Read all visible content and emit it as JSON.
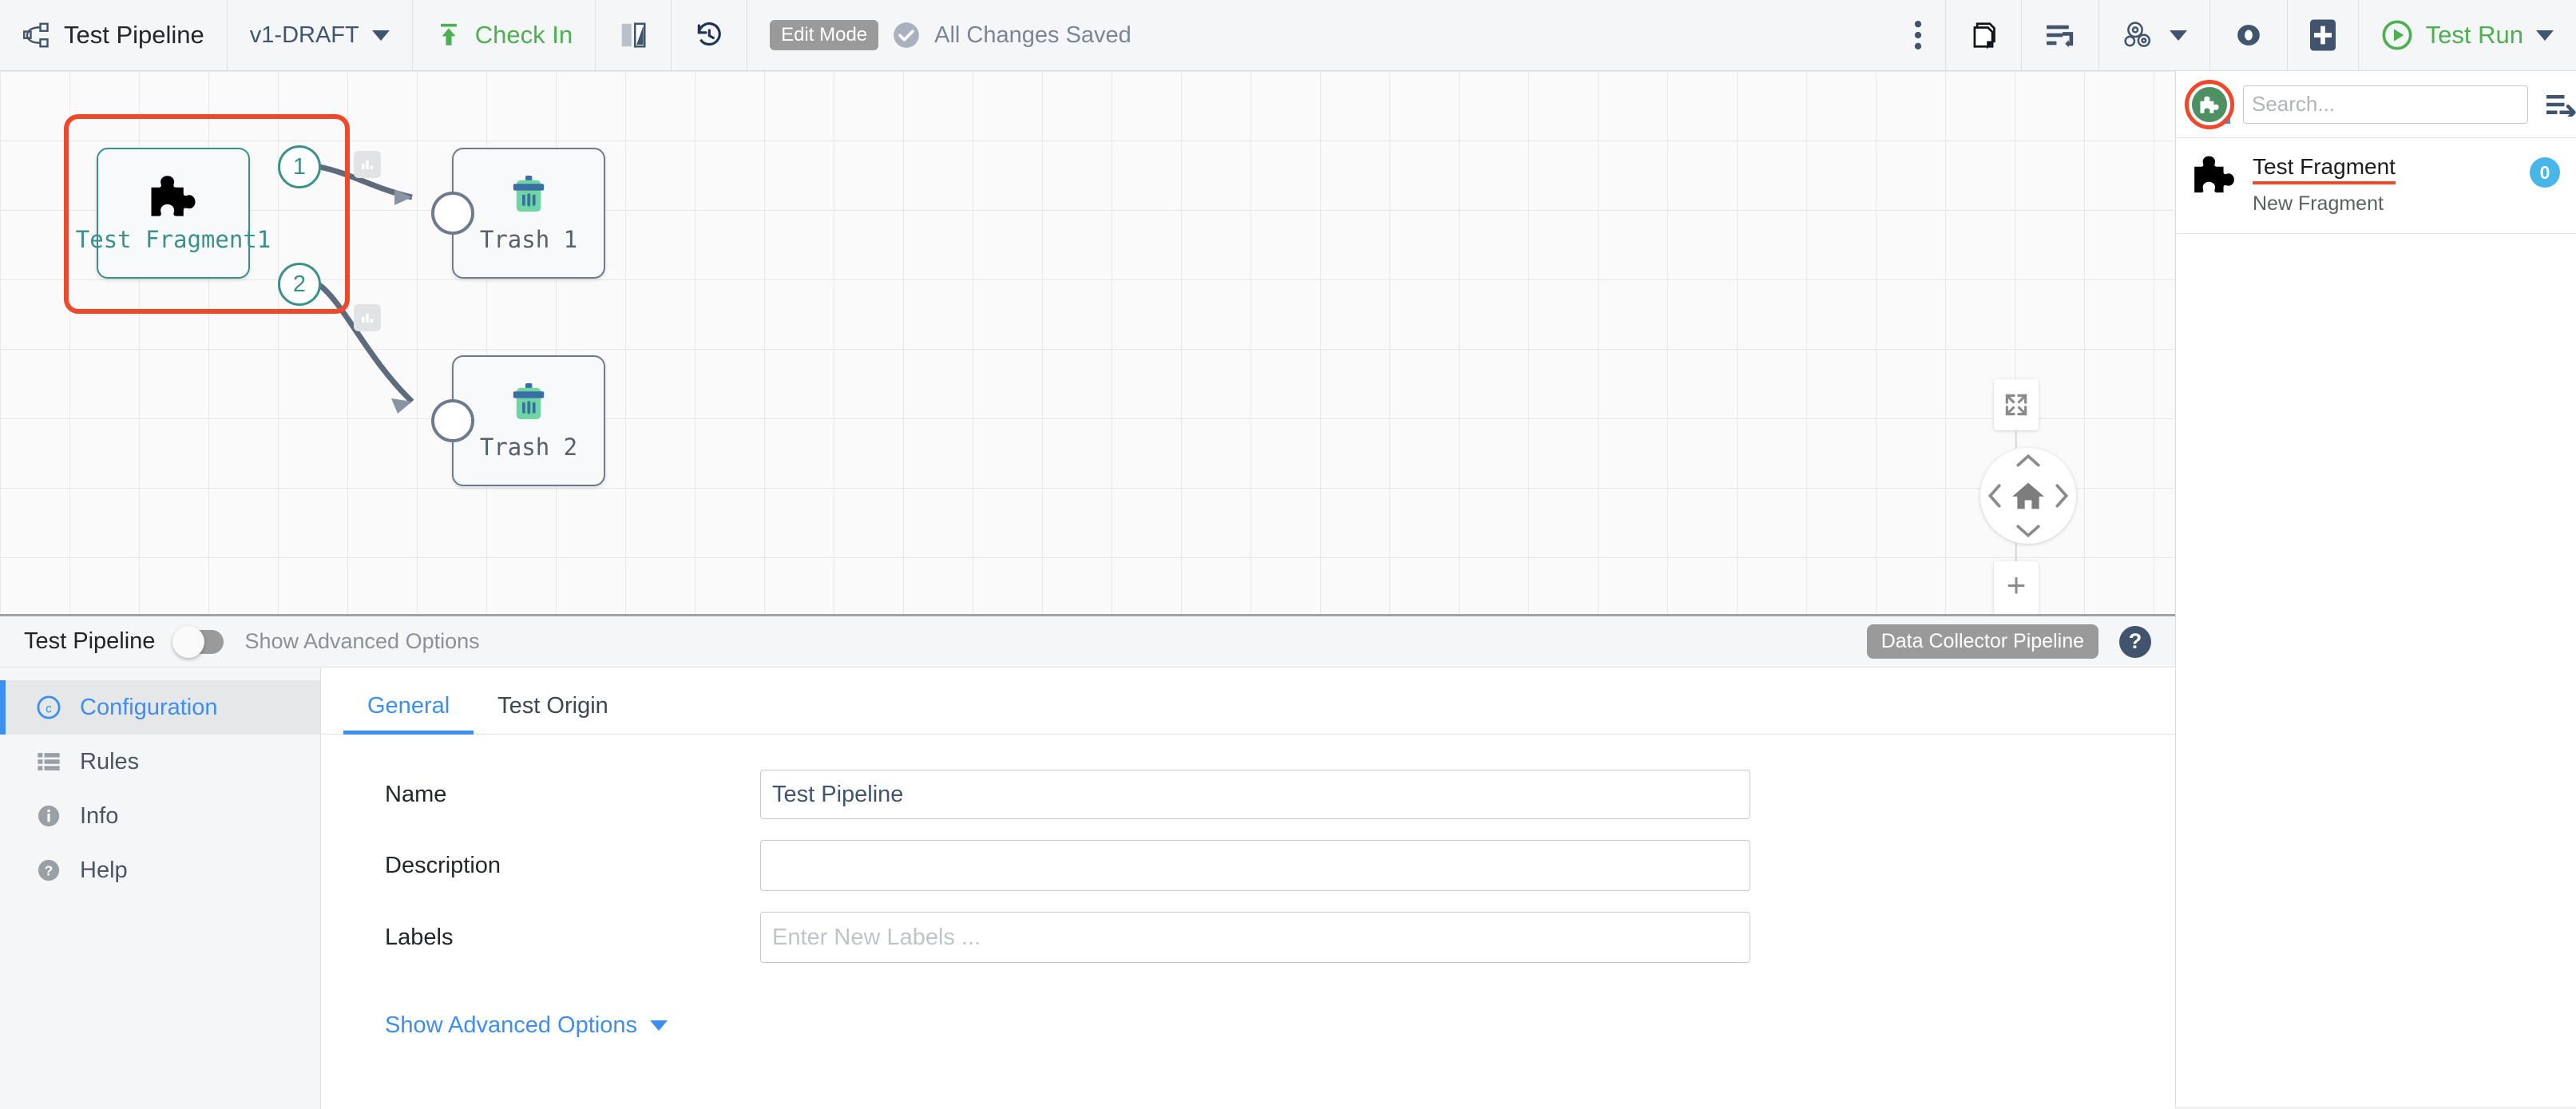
{
  "toolbar": {
    "pipeline_icon": "pipeline-nodes-icon",
    "pipeline_title": "Test Pipeline",
    "version": "v1-DRAFT",
    "check_in_label": "Check In",
    "preview_icon": "split-preview-icon",
    "history_icon": "history-clock-icon",
    "edit_mode_chip": "Edit Mode",
    "saved_status": "All Changes Saved",
    "saved_icon": "check-circle-icon",
    "more_icon": "kebab-menu-icon",
    "duplicate_icon": "copy-pages-icon",
    "sort_icon": "arrange-lines-icon",
    "gears_icon": "gears-icon",
    "eye_icon": "eye-preview-icon",
    "add_icon": "plus-square-icon",
    "test_run_label": "Test Run",
    "test_run_icon": "play-circle-icon",
    "accent_green": "#4caf50",
    "accent_navy": "#41546e"
  },
  "canvas": {
    "nodes": [
      {
        "id": "fragment",
        "label": "Test Fragment1",
        "icon": "puzzle-piece-icon",
        "border_color": "#3a9188"
      },
      {
        "id": "trash1",
        "label": "Trash 1",
        "icon": "trash-can-icon",
        "border_color": "#6d7b8d"
      },
      {
        "id": "trash2",
        "label": "Trash 2",
        "icon": "trash-can-icon",
        "border_color": "#6d7b8d"
      }
    ],
    "ports": {
      "out1": "1",
      "out2": "2"
    },
    "stats_badge_icon": "bar-chart-icon",
    "highlight_color": "#f1482a",
    "nav": {
      "fit_icon": "fit-to-screen-icon",
      "home_icon": "home-icon",
      "pan_up_icon": "chevron-up-icon",
      "pan_down_icon": "chevron-down-icon",
      "pan_left_icon": "chevron-left-icon",
      "pan_right_icon": "chevron-right-icon",
      "zoom_in": "+",
      "zoom_out": "–"
    }
  },
  "stage_panel": {
    "add_stage_icon": "green-puzzle-add-icon",
    "search_placeholder": "Search...",
    "search_value": "",
    "collapse_icon": "collapse-panel-icon",
    "items": [
      {
        "icon": "puzzle-piece-icon",
        "title": "Test Fragment",
        "subtitle": "New Fragment",
        "count": "0"
      }
    ]
  },
  "properties": {
    "header": {
      "title": "Test Pipeline",
      "toggle_state": "off",
      "toggle_label": "Show Advanced Options",
      "type_chip": "Data Collector Pipeline",
      "help_icon": "question-circle-icon"
    },
    "sidebar": [
      {
        "label": "Configuration",
        "icon": "config-c-icon",
        "active": true
      },
      {
        "label": "Rules",
        "icon": "list-rules-icon",
        "active": false
      },
      {
        "label": "Info",
        "icon": "info-circle-icon",
        "active": false
      },
      {
        "label": "Help",
        "icon": "help-circle-icon",
        "active": false
      }
    ],
    "tabs": [
      {
        "label": "General",
        "active": true
      },
      {
        "label": "Test Origin",
        "active": false
      }
    ],
    "fields": [
      {
        "label": "Name",
        "value": "Test Pipeline",
        "placeholder": ""
      },
      {
        "label": "Description",
        "value": "",
        "placeholder": ""
      },
      {
        "label": "Labels",
        "value": "",
        "placeholder": "Enter New Labels ..."
      }
    ],
    "advanced_link": "Show Advanced Options"
  }
}
